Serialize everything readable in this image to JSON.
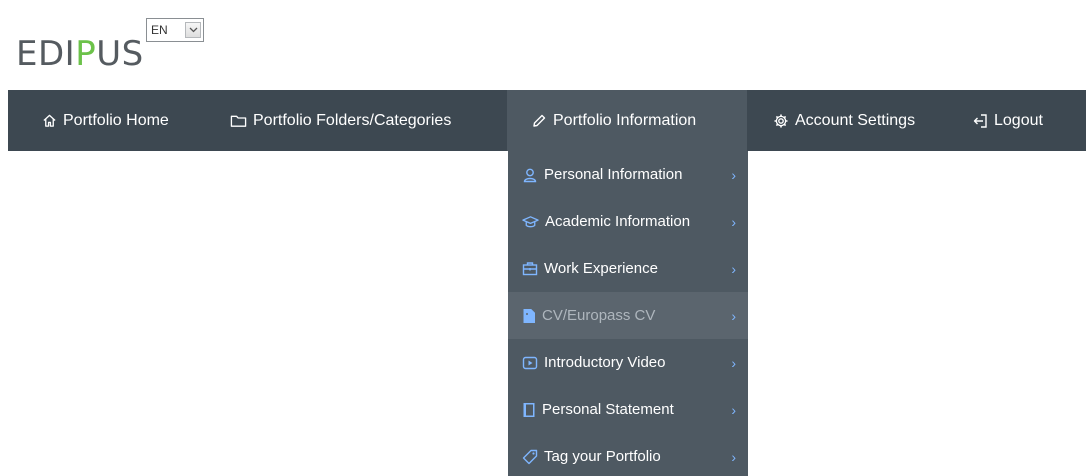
{
  "brand": {
    "logo_prefix": "EDI",
    "logo_accent": "P",
    "logo_suffix": "US",
    "accent_color": "#6cc24a"
  },
  "language": {
    "selected": "EN",
    "dropdown_glyph": "⌄"
  },
  "nav": {
    "items": [
      {
        "label": "Portfolio Home",
        "icon": "home-icon"
      },
      {
        "label": "Portfolio Folders/Categories",
        "icon": "folder-icon"
      },
      {
        "label": "Portfolio Information",
        "icon": "pencil-icon",
        "active": true
      },
      {
        "label": "Account Settings",
        "icon": "gear-icon"
      },
      {
        "label": "Logout",
        "icon": "logout-icon"
      }
    ]
  },
  "dropdown": {
    "items": [
      {
        "label": "Personal Information",
        "icon": "user-icon"
      },
      {
        "label": "Academic Information",
        "icon": "graduation-cap-icon"
      },
      {
        "label": "Work Experience",
        "icon": "briefcase-icon"
      },
      {
        "label": "CV/Europass CV",
        "icon": "document-icon",
        "selected": true
      },
      {
        "label": "Introductory Video",
        "icon": "video-icon"
      },
      {
        "label": "Personal Statement",
        "icon": "book-icon"
      },
      {
        "label": "Tag your Portfolio",
        "icon": "tag-icon"
      }
    ],
    "chevron": "›"
  },
  "colors": {
    "navbar_bg": "#3d4851",
    "dropdown_bg": "#4e5962",
    "selected_bg": "#5b656e",
    "icon_blue": "#7fb6ff"
  }
}
